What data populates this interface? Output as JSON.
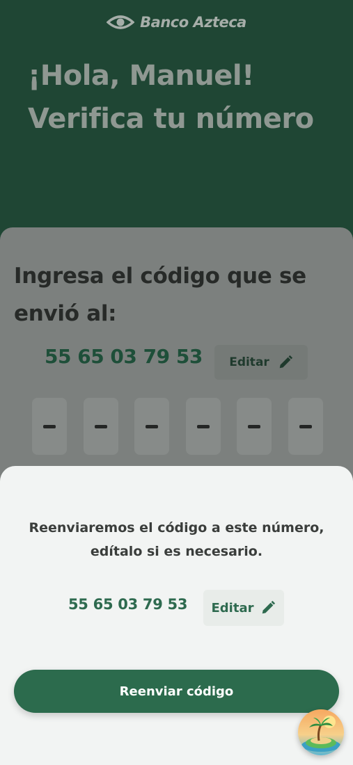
{
  "header": {
    "brand_name": "Banco Azteca",
    "greeting": "¡Hola, Manuel! Verifica tu número"
  },
  "card": {
    "title": "Ingresa el código que se envió al:",
    "phone_number": "55 65 03 79 53",
    "edit_label": "Editar",
    "otp_placeholders": [
      "-",
      "-",
      "-",
      "-",
      "-",
      "-"
    ]
  },
  "sheet": {
    "message": "Reenviaremos el código a este número, edítalo si es necesario.",
    "phone_number": "55 65 03 79 53",
    "edit_label": "Editar",
    "resend_label": "Reenviar código"
  },
  "assistant": {
    "icon": "island-assistant-icon"
  },
  "colors": {
    "header_bg": "#1f4634",
    "primary_green": "#2c6b4d",
    "sheet_bg": "#f2f4f3"
  }
}
